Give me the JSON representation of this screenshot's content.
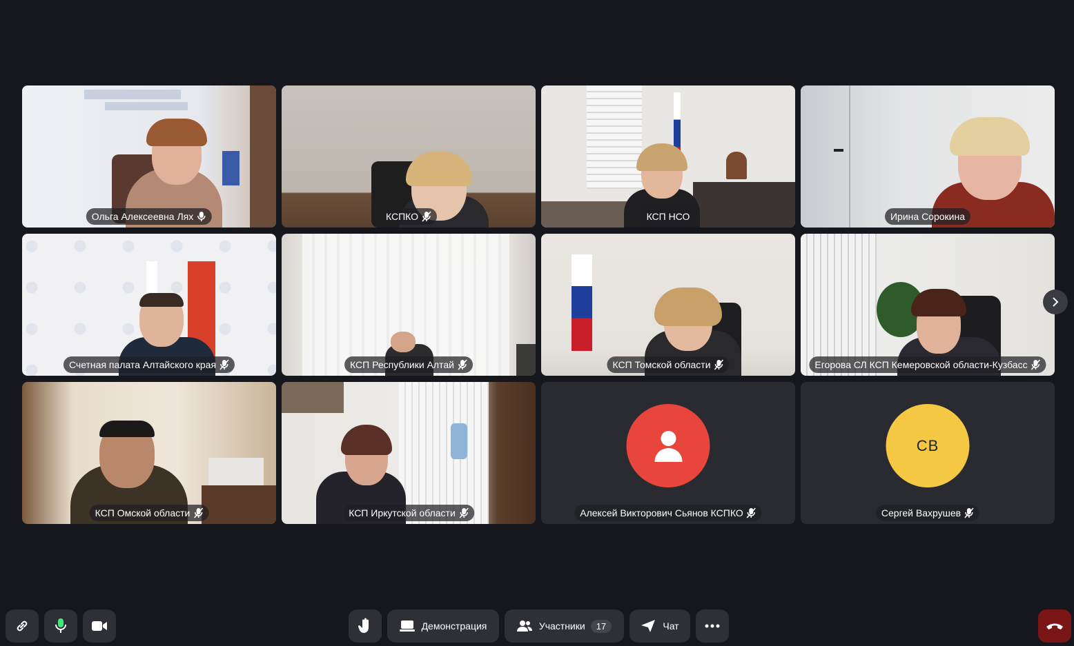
{
  "tiles": [
    {
      "name": "Ольга Алексеевна Лях",
      "muted": false,
      "speaking": true
    },
    {
      "name": "КСПКО",
      "muted": true,
      "speaking": false
    },
    {
      "name": "КСП НСО",
      "muted": false,
      "speaking": false
    },
    {
      "name": "Ирина Сорокина",
      "muted": false,
      "speaking": true
    },
    {
      "name": "Счетная палата Алтайского края",
      "muted": true,
      "speaking": false
    },
    {
      "name": "КСП Республики Алтай",
      "muted": true,
      "speaking": false
    },
    {
      "name": "КСП Томской области",
      "muted": true,
      "speaking": false
    },
    {
      "name": "Егорова СЛ КСП Кемеровской области-Кузбасс",
      "muted": true,
      "speaking": false
    },
    {
      "name": "КСП Омской области",
      "muted": true,
      "speaking": false
    },
    {
      "name": "КСП Иркутской области",
      "muted": true,
      "speaking": false
    },
    {
      "name": "Алексей Викторович Сьянов КСПКО",
      "muted": true,
      "speaking": false,
      "avatar_color": "#e8453c"
    },
    {
      "name": "Сергей Вахрушев",
      "muted": true,
      "speaking": false,
      "initials": "СВ",
      "avatar_color": "#f4c842"
    }
  ],
  "toolbar": {
    "link_icon": "link-icon",
    "mic_icon": "microphone-icon",
    "camera_icon": "camera-icon",
    "raise_hand_icon": "raise-hand-icon",
    "screen_share_label": "Демонстрация",
    "participants_label": "Участники",
    "participants_count": "17",
    "chat_label": "Чат",
    "more_icon": "more-icon",
    "end_call_icon": "end-call-icon"
  },
  "colors": {
    "speaking_border": "#3ee87a",
    "end_call": "#7a1616",
    "mic_active": "#3ee87a"
  }
}
